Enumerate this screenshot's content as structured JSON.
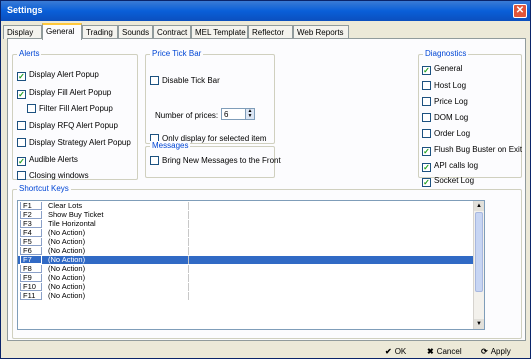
{
  "window": {
    "title": "Settings",
    "close_glyph": "✕"
  },
  "tabs": [
    "Display",
    "General",
    "Trading",
    "Sounds",
    "Contract",
    "MEL Template",
    "Reflector",
    "Web Reports"
  ],
  "active_tab": "General",
  "alerts": {
    "legend": "Alerts",
    "items": [
      {
        "label": "Display Alert Popup",
        "checked": true
      },
      {
        "label": "Display Fill Alert Popup",
        "checked": true
      },
      {
        "label": "Filter Fill Alert Popup",
        "checked": false
      },
      {
        "label": "Display RFQ Alert Popup",
        "checked": false
      },
      {
        "label": "Display Strategy Alert Popup",
        "checked": false
      },
      {
        "label": "Audible Alerts",
        "checked": true
      },
      {
        "label": "Closing windows",
        "checked": false
      }
    ]
  },
  "price_tick_bar": {
    "legend": "Price Tick Bar",
    "disable_label": "Disable Tick Bar",
    "disable_checked": false,
    "number_label": "Number of prices:",
    "number_value": "6",
    "only_selected_label": "Only display for selected item",
    "only_selected_checked": false
  },
  "messages": {
    "legend": "Messages",
    "bring_front_label": "Bring New Messages to the Front",
    "bring_front_checked": false
  },
  "diagnostics": {
    "legend": "Diagnostics",
    "items": [
      {
        "label": "General",
        "checked": true
      },
      {
        "label": "Host Log",
        "checked": false
      },
      {
        "label": "Price Log",
        "checked": false
      },
      {
        "label": "DOM Log",
        "checked": false
      },
      {
        "label": "Order Log",
        "checked": false
      },
      {
        "label": "Flush Bug Buster on Exit",
        "checked": true
      },
      {
        "label": "API calls log",
        "checked": true
      },
      {
        "label": "Socket Log",
        "checked": true
      }
    ]
  },
  "shortcut_keys": {
    "legend": "Shortcut Keys",
    "rows": [
      {
        "key": "F1",
        "action": "Clear Lots"
      },
      {
        "key": "F2",
        "action": "Show Buy Ticket"
      },
      {
        "key": "F3",
        "action": "Tile Horizontal"
      },
      {
        "key": "F4",
        "action": "(No Action)"
      },
      {
        "key": "F5",
        "action": "(No Action)"
      },
      {
        "key": "F6",
        "action": "(No Action)"
      },
      {
        "key": "F7",
        "action": "(No Action)"
      },
      {
        "key": "F8",
        "action": "(No Action)"
      },
      {
        "key": "F9",
        "action": "(No Action)"
      },
      {
        "key": "F10",
        "action": "(No Action)"
      },
      {
        "key": "F11",
        "action": "(No Action)"
      }
    ],
    "selected_key": "F7"
  },
  "buttons": {
    "ok": "OK",
    "cancel": "Cancel",
    "apply": "Apply"
  },
  "colors": {
    "title_bar": "#0a5fd8",
    "legend_text": "#0046d5",
    "selection": "#316ac5",
    "check_mark": "#21a121"
  }
}
